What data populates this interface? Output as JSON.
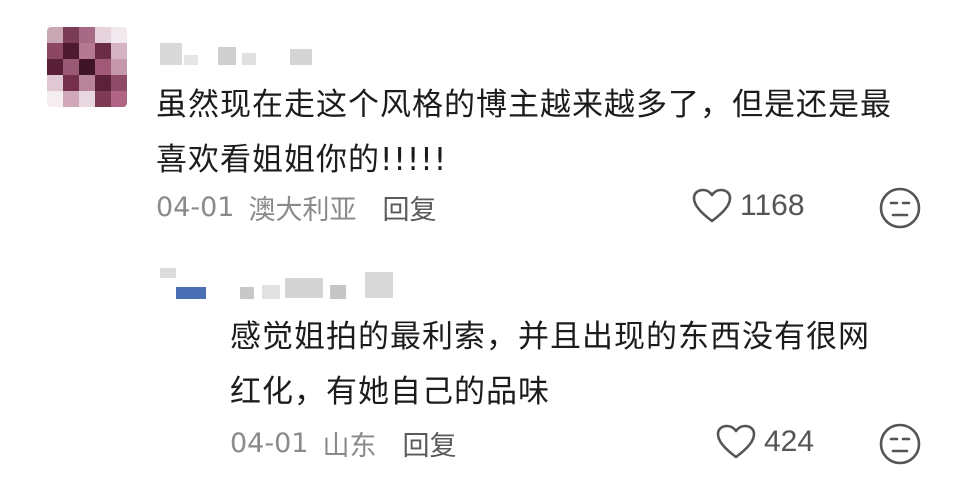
{
  "comments": [
    {
      "text_line1": "虽然现在走这个风格的博主越来越多了，但是还是最",
      "text_line2": "喜欢看姐姐你的!!!!!",
      "date": "04-01",
      "location": "澳大利亚",
      "reply_label": "回复",
      "likes": "1168",
      "like_icon": "heart-outline-icon",
      "reaction_icon": "meh-face-icon"
    },
    {
      "text_line1": "感觉姐拍的最利索，并且出现的东西没有很网",
      "text_line2": "红化，有她自己的品味",
      "date": "04-01",
      "location": "山东",
      "reply_label": "回复",
      "likes": "424",
      "like_icon": "heart-outline-icon",
      "reaction_icon": "meh-face-icon"
    }
  ],
  "colors": {
    "text": "#1c1c1c",
    "meta": "#8a8a8a",
    "icon": "#555555"
  }
}
